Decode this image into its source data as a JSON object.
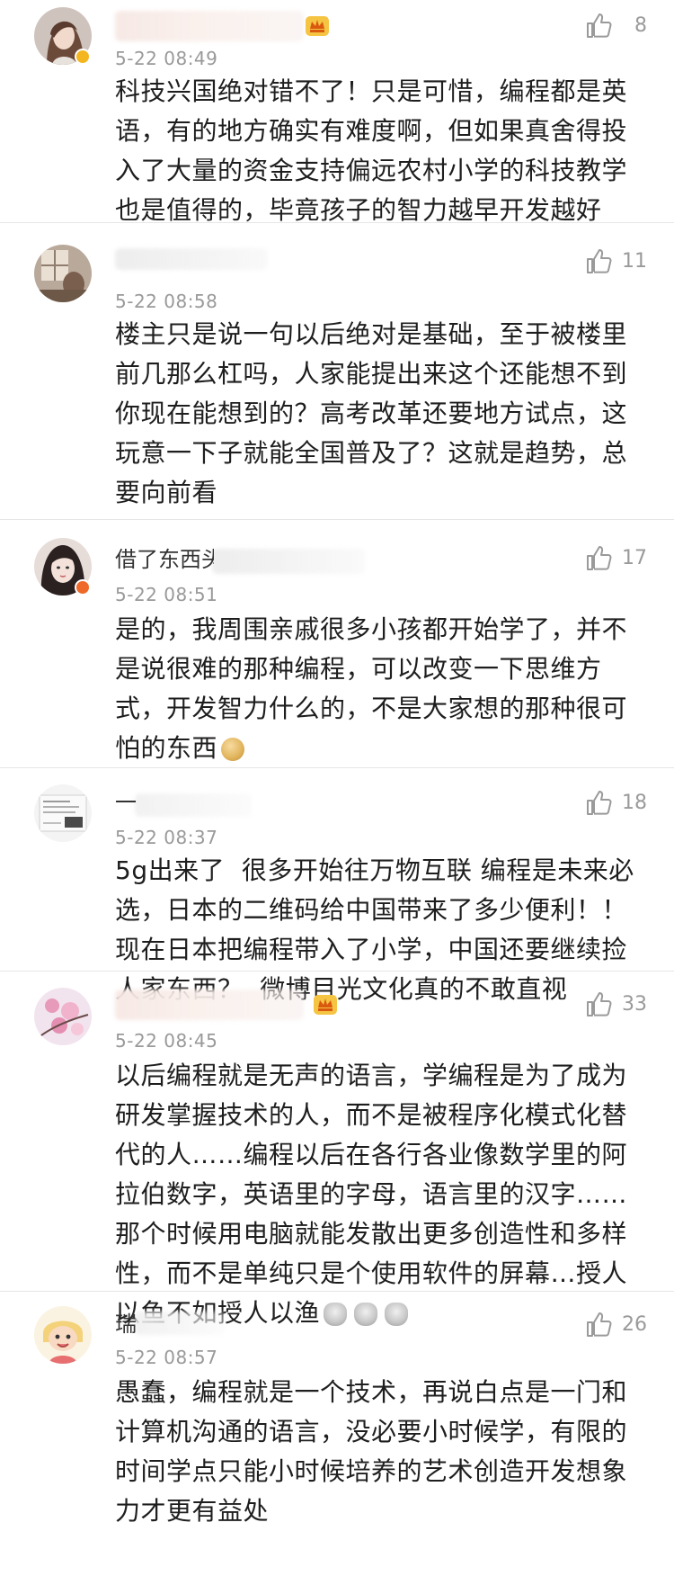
{
  "colors": {
    "text": "#1e1e1e",
    "meta": "#999999",
    "divider": "#e6e6e6",
    "vip_gold": "#e7a417"
  },
  "comments": [
    {
      "username": "",
      "timestamp": "5-22 08:49",
      "likes": "8",
      "text": "科技兴国绝对错不了！只是可惜，编程都是英语，有的地方确实有难度啊，但如果真舍得投入了大量的资金支持偏远农村小学的科技教学也是值得的，毕竟孩子的智力越早开发越好",
      "avatar": "woman-portrait-avatar",
      "badge": "verified-yellow"
    },
    {
      "username": "",
      "timestamp": "5-22 08:58",
      "likes": "11",
      "text": "楼主只是说一句以后绝对是基础，至于被楼里前几那么杠吗，人家能提出来这个还能想不到你现在能想到的？高考改革还要地方试点，这玩意一下子就能全国普及了？这就是趋势，总要向前看",
      "avatar": "window-scene-avatar",
      "badge": ""
    },
    {
      "username": "借了东西头什么不还",
      "timestamp": "5-22 08:51",
      "likes": "17",
      "text": "是的，我周围亲戚很多小孩都开始学了，并不是说很难的那种编程，可以改变一下思维方式，开发智力什么的，不是大家想的那种很可怕的东西",
      "avatar": "girl-portrait-avatar",
      "badge": "verified-orange",
      "emoji": [
        "sweat-emoji"
      ]
    },
    {
      "username": "一 ",
      "timestamp": "5-22 08:37",
      "likes": "18",
      "text": "5g出来了  很多开始往万物互联 编程是未来必选，日本的二维码给中国带来了多少便利！！现在日本把编程带入了小学，中国还要继续捡人家东西？  微博目光文化真的不敢直视",
      "avatar": "document-avatar",
      "badge": ""
    },
    {
      "username": "",
      "timestamp": "5-22 08:45",
      "likes": "33",
      "text": "以后编程就是无声的语言，学编程是为了成为研发掌握技术的人，而不是被程序化模式化替代的人……编程以后在各行各业像数学里的阿拉伯数字，英语里的字母，语言里的汉字……那个时候用电脑就能发散出更多创造性和多样性，而不是单纯只是个使用软件的屏幕…授人以鱼不如授人以渔",
      "avatar": "cherry-blossom-avatar",
      "badge": "",
      "emoji": [
        "robot-emoji",
        "robot-emoji",
        "robot-emoji"
      ]
    },
    {
      "username": "瑞",
      "timestamp": "5-22 08:57",
      "likes": "26",
      "text": "愚蠢，编程就是一个技术，再说白点是一门和计算机沟通的语言，没必要小时候学，有限的时间学点只能小时候培养的艺术创造开发想象力才更有益处",
      "avatar": "cartoon-avatar",
      "badge": ""
    }
  ]
}
